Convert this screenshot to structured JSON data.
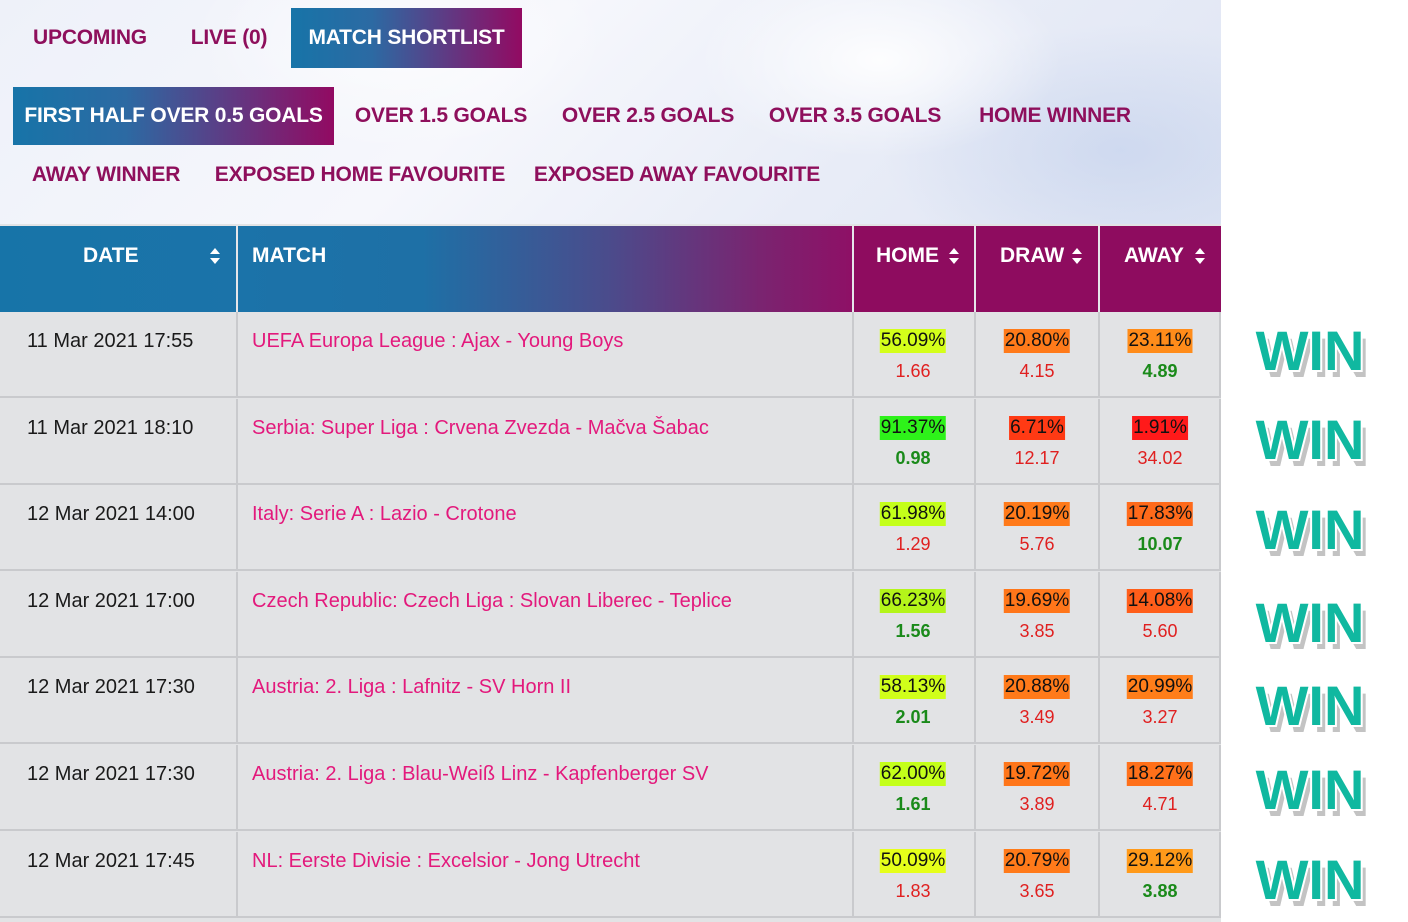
{
  "tabs": [
    {
      "label": "UPCOMING",
      "active": false
    },
    {
      "label": "LIVE (0)",
      "active": false
    },
    {
      "label": "MATCH SHORTLIST",
      "active": true
    }
  ],
  "filters": [
    {
      "label": "FIRST HALF OVER 0.5 GOALS",
      "active": true
    },
    {
      "label": "OVER 1.5 GOALS",
      "active": false
    },
    {
      "label": "OVER 2.5 GOALS",
      "active": false
    },
    {
      "label": "OVER 3.5 GOALS",
      "active": false
    },
    {
      "label": "HOME WINNER",
      "active": false
    },
    {
      "label": "AWAY WINNER",
      "active": false
    },
    {
      "label": "EXPOSED HOME FAVOURITE",
      "active": false
    },
    {
      "label": "EXPOSED AWAY FAVOURITE",
      "active": false
    }
  ],
  "columns": {
    "date": "DATE",
    "match": "MATCH",
    "home": "HOME",
    "draw": "DRAW",
    "away": "AWAY"
  },
  "win_label": "WIN",
  "colors": {
    "accent_blue": "#1774a8",
    "accent_magenta": "#920a62",
    "match_link": "#e3197c",
    "win_teal": "#10b8a0",
    "odd_red": "#e02020",
    "odd_green": "#1a8a1a"
  },
  "rows": [
    {
      "date": "11 Mar 2021 17:55",
      "match": "UEFA Europa League : Ajax - Young Boys",
      "home": {
        "pct": "56.09%",
        "odd": "1.66",
        "bg": "#d4ff1a",
        "odd_color": "red"
      },
      "draw": {
        "pct": "20.80%",
        "odd": "4.15",
        "bg": "#ff7a1a",
        "odd_color": "red"
      },
      "away": {
        "pct": "23.11%",
        "odd": "4.89",
        "bg": "#ff8c1a",
        "odd_color": "green"
      }
    },
    {
      "date": "11 Mar 2021 18:10",
      "match": "Serbia: Super Liga : Crvena Zvezda - Mačva Šabac",
      "home": {
        "pct": "91.37%",
        "odd": "0.98",
        "bg": "#2ef21a",
        "odd_color": "green"
      },
      "draw": {
        "pct": "6.71%",
        "odd": "12.17",
        "bg": "#ff3a14",
        "odd_color": "red"
      },
      "away": {
        "pct": "1.91%",
        "odd": "34.02",
        "bg": "#ff1a1a",
        "odd_color": "red"
      }
    },
    {
      "date": "12 Mar 2021 14:00",
      "match": "Italy: Serie A : Lazio - Crotone",
      "home": {
        "pct": "61.98%",
        "odd": "1.29",
        "bg": "#c4ff1a",
        "odd_color": "red"
      },
      "draw": {
        "pct": "20.19%",
        "odd": "5.76",
        "bg": "#ff7a1a",
        "odd_color": "red"
      },
      "away": {
        "pct": "17.83%",
        "odd": "10.07",
        "bg": "#ff6a1a",
        "odd_color": "green"
      }
    },
    {
      "date": "12 Mar 2021 17:00",
      "match": "Czech Republic: Czech Liga : Slovan Liberec - Teplice",
      "home": {
        "pct": "66.23%",
        "odd": "1.56",
        "bg": "#b4f51a",
        "odd_color": "green"
      },
      "draw": {
        "pct": "19.69%",
        "odd": "3.85",
        "bg": "#ff761a",
        "odd_color": "red"
      },
      "away": {
        "pct": "14.08%",
        "odd": "5.60",
        "bg": "#ff5e1a",
        "odd_color": "red"
      }
    },
    {
      "date": "12 Mar 2021 17:30",
      "match": "Austria: 2. Liga : Lafnitz - SV Horn II",
      "home": {
        "pct": "58.13%",
        "odd": "2.01",
        "bg": "#d0ff1a",
        "odd_color": "green"
      },
      "draw": {
        "pct": "20.88%",
        "odd": "3.49",
        "bg": "#ff7a1a",
        "odd_color": "red"
      },
      "away": {
        "pct": "20.99%",
        "odd": "3.27",
        "bg": "#ff7e1a",
        "odd_color": "red"
      }
    },
    {
      "date": "12 Mar 2021 17:30",
      "match": "Austria: 2. Liga : Blau-Weiß Linz - Kapfenberger SV",
      "home": {
        "pct": "62.00%",
        "odd": "1.61",
        "bg": "#c4ff1a",
        "odd_color": "green"
      },
      "draw": {
        "pct": "19.72%",
        "odd": "3.89",
        "bg": "#ff761a",
        "odd_color": "red"
      },
      "away": {
        "pct": "18.27%",
        "odd": "4.71",
        "bg": "#ff701a",
        "odd_color": "red"
      }
    },
    {
      "date": "12 Mar 2021 17:45",
      "match": "NL: Eerste Divisie : Excelsior - Jong Utrecht",
      "home": {
        "pct": "50.09%",
        "odd": "1.83",
        "bg": "#e6ff1a",
        "odd_color": "red"
      },
      "draw": {
        "pct": "20.79%",
        "odd": "3.65",
        "bg": "#ff7a1a",
        "odd_color": "red"
      },
      "away": {
        "pct": "29.12%",
        "odd": "3.88",
        "bg": "#ff9a1a",
        "odd_color": "green"
      }
    }
  ]
}
